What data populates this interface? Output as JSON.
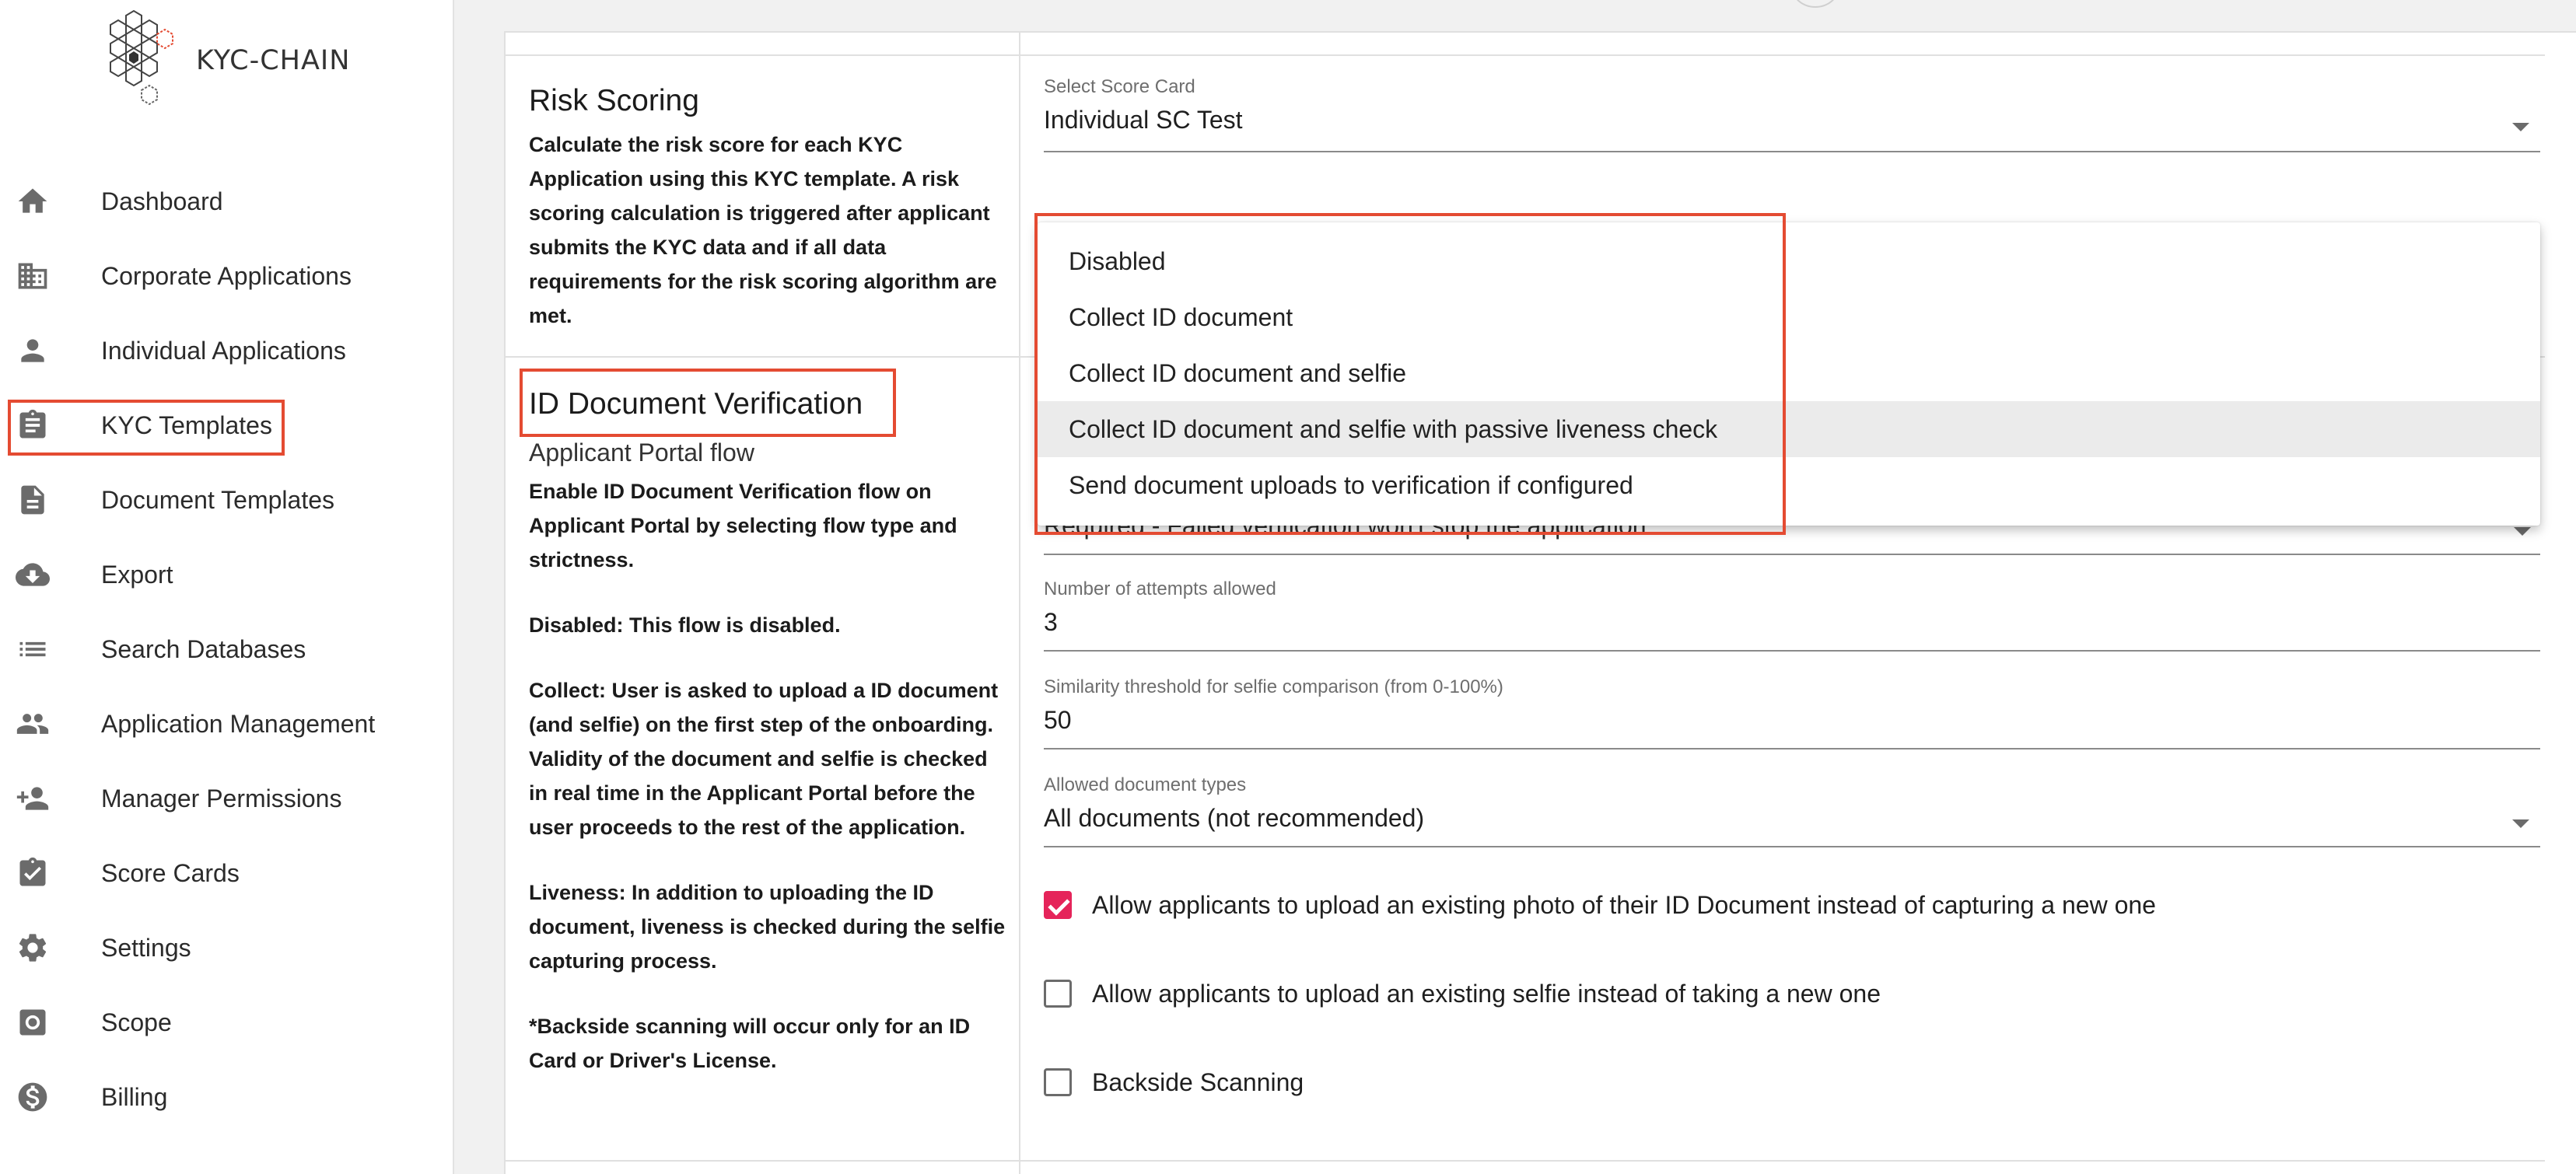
{
  "app": {
    "logo_text": "KYC-CHAIN"
  },
  "sidebar": {
    "items": [
      {
        "label": "Dashboard",
        "icon": "home-icon"
      },
      {
        "label": "Corporate Applications",
        "icon": "building-icon"
      },
      {
        "label": "Individual Applications",
        "icon": "person-icon"
      },
      {
        "label": "KYC Templates",
        "icon": "clipboard-icon"
      },
      {
        "label": "Document Templates",
        "icon": "document-icon"
      },
      {
        "label": "Export",
        "icon": "cloud-download-icon"
      },
      {
        "label": "Search Databases",
        "icon": "list-icon"
      },
      {
        "label": "Application Management",
        "icon": "people-icon"
      },
      {
        "label": "Manager Permissions",
        "icon": "person-add-icon"
      },
      {
        "label": "Score Cards",
        "icon": "clipboard-check-icon"
      },
      {
        "label": "Settings",
        "icon": "gear-icon"
      },
      {
        "label": "Scope",
        "icon": "scope-icon"
      },
      {
        "label": "Billing",
        "icon": "dollar-circle-icon"
      }
    ]
  },
  "risk_scoring": {
    "title": "Risk Scoring",
    "description": "Calculate the risk score for each KYC Application using this KYC template. A risk scoring calculation is triggered after applicant submits the KYC data and if all data requirements for the risk scoring algorithm are met.",
    "score_card_label": "Select Score Card",
    "score_card_value": "Individual SC Test"
  },
  "id_verification": {
    "title": "ID Document Verification",
    "subtitle": "Applicant Portal flow",
    "paragraphs": [
      "Enable ID Document Verification flow on Applicant Portal by selecting flow type and strictness.",
      "Disabled: This flow is disabled.",
      "Collect: User is asked to upload a ID document (and selfie) on the first step of the onboarding. Validity of the document and selfie is checked in real time in the Applicant Portal before the user proceeds to the rest of the application.",
      "Liveness: In addition to uploading the ID document, liveness is checked during the selfie capturing process.",
      "*Backside scanning will occur only for an ID Card or Driver's License."
    ],
    "strictness_value_partial": "Required - Failed verification won't stop the application",
    "attempts_label": "Number of attempts allowed",
    "attempts_value": "3",
    "similarity_label": "Similarity threshold for selfie comparison (from 0-100%)",
    "similarity_value": "50",
    "doc_types_label": "Allowed document types",
    "doc_types_value": "All documents (not recommended)",
    "checkboxes": [
      {
        "label": "Allow applicants to upload an existing photo of their ID Document instead of capturing a new one",
        "checked": true
      },
      {
        "label": "Allow applicants to upload an existing selfie instead of taking a new one",
        "checked": false
      },
      {
        "label": "Backside Scanning",
        "checked": false
      }
    ]
  },
  "flow_menu": {
    "options": [
      "Disabled",
      "Collect ID document",
      "Collect ID document and selfie",
      "Collect ID document and selfie with passive liveness check",
      "Send document uploads to verification if configured"
    ],
    "hovered_index": 3
  },
  "colors": {
    "highlight": "#e44b32",
    "checkbox_accent": "#e5245a"
  }
}
